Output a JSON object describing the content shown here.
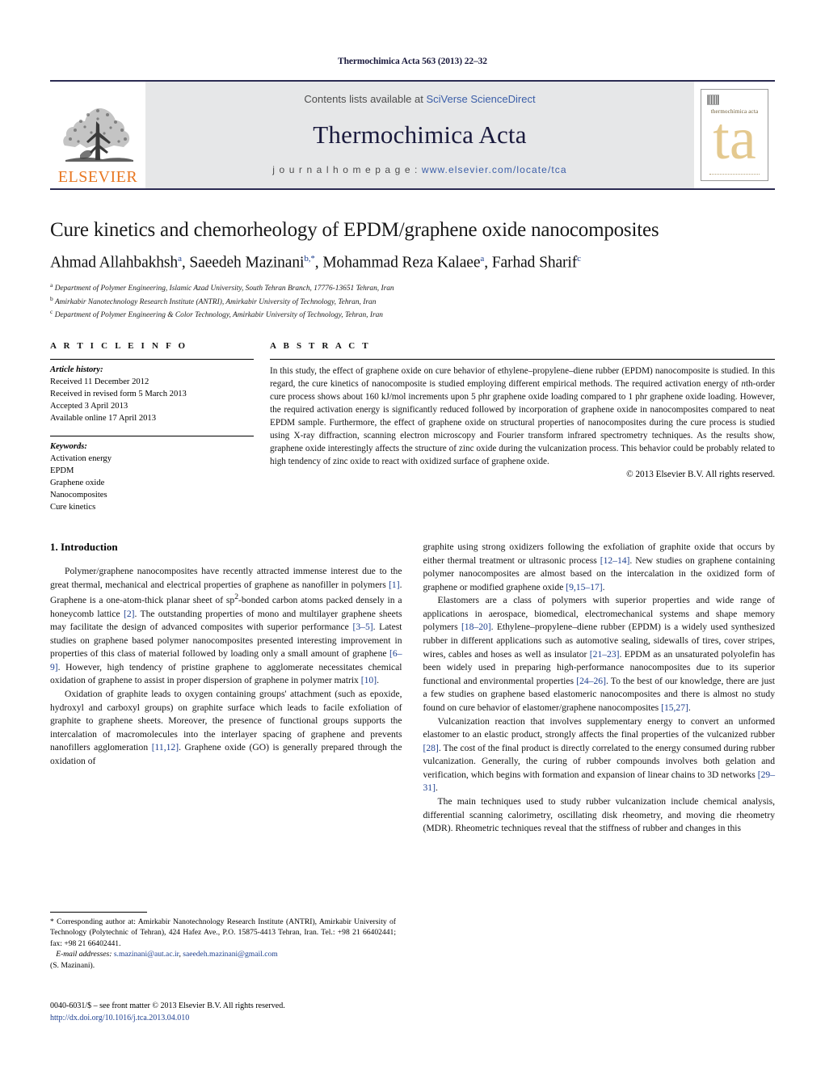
{
  "running_head": "Thermochimica Acta 563 (2013) 22–32",
  "masthead": {
    "publisher_name": "ELSEVIER",
    "contents_prefix": "Contents lists available at ",
    "contents_link": "SciVerse ScienceDirect",
    "journal_name": "Thermochimica Acta",
    "homepage_prefix": "j o u r n a l   h o m e p a g e :   ",
    "homepage_url": "www.elsevier.com/locate/tca",
    "cover_title": "thermochimica acta",
    "cover_logo_text": "ta",
    "accent_orange": "#E87722",
    "accent_blue": "#3b5ea8",
    "band_gray": "#e6e7e8",
    "cover_tan": "#e4c98f"
  },
  "article": {
    "title": "Cure kinetics and chemorheology of EPDM/graphene oxide nanocomposites",
    "authors_html": "Ahmad Allahbakhsh<sup>a</sup>, Saeedeh Mazinani<sup>b,*</sup>, Mohammad Reza Kalaee<sup>a</sup>, Farhad Sharif<sup>c</sup>",
    "affiliations": [
      "Department of Polymer Engineering, Islamic Azad University, South Tehran Branch, 17776-13651 Tehran, Iran",
      "Amirkabir Nanotechnology Research Institute (ANTRI), Amirkabir University of Technology, Tehran, Iran",
      "Department of Polymer Engineering & Color Technology, Amirkabir University of Technology, Tehran, Iran"
    ],
    "affiliation_marks": [
      "a",
      "b",
      "c"
    ]
  },
  "article_info": {
    "heading": "A R T I C L E   I N F O",
    "history_label": "Article history:",
    "history": [
      "Received 11 December 2012",
      "Received in revised form 5 March 2013",
      "Accepted 3 April 2013",
      "Available online 17 April 2013"
    ],
    "keywords_label": "Keywords:",
    "keywords": [
      "Activation energy",
      "EPDM",
      "Graphene oxide",
      "Nanocomposites",
      "Cure kinetics"
    ]
  },
  "abstract": {
    "heading": "A B S T R A C T",
    "text": "In this study, the effect of graphene oxide on cure behavior of ethylene–propylene–diene rubber (EPDM) nanocomposite is studied. In this regard, the cure kinetics of nanocomposite is studied employing different empirical methods. The required activation energy of nth-order cure process shows about 160 kJ/mol increments upon 5 phr graphene oxide loading compared to 1 phr graphene oxide loading. However, the required activation energy is significantly reduced followed by incorporation of graphene oxide in nanocomposites compared to neat EPDM sample. Furthermore, the effect of graphene oxide on structural properties of nanocomposites during the cure process is studied using X-ray diffraction, scanning electron microscopy and Fourier transform infrared spectrometry techniques. As the results show, graphene oxide interestingly affects the structure of zinc oxide during the vulcanization process. This behavior could be probably related to high tendency of zinc oxide to react with oxidized surface of graphene oxide.",
    "copyright": "© 2013 Elsevier B.V. All rights reserved."
  },
  "introduction": {
    "section_number_title": "1.  Introduction",
    "left_paragraphs": [
      "Polymer/graphene nanocomposites have recently attracted immense interest due to the great thermal, mechanical and electrical properties of graphene as nanofiller in polymers [1]. Graphene is a one-atom-thick planar sheet of sp2-bonded carbon atoms packed densely in a honeycomb lattice [2]. The outstanding properties of mono and multilayer graphene sheets may facilitate the design of advanced composites with superior performance [3–5]. Latest studies on graphene based polymer nanocomposites presented interesting improvement in properties of this class of material followed by loading only a small amount of graphene [6–9]. However, high tendency of pristine graphene to agglomerate necessitates chemical oxidation of graphene to assist in proper dispersion of graphene in polymer matrix [10].",
      "Oxidation of graphite leads to oxygen containing groups' attachment (such as epoxide, hydroxyl and carboxyl groups) on graphite surface which leads to facile exfoliation of graphite to graphene sheets. Moreover, the presence of functional groups supports the intercalation of macromolecules into the interlayer spacing of graphene and prevents nanofillers agglomeration [11,12]. Graphene oxide (GO) is generally prepared through the oxidation of"
    ],
    "right_paragraphs": [
      "graphite using strong oxidizers following the exfoliation of graphite oxide that occurs by either thermal treatment or ultrasonic process [12–14]. New studies on graphene containing polymer nanocomposites are almost based on the intercalation in the oxidized form of graphene or modified graphene oxide [9,15–17].",
      "Elastomers are a class of polymers with superior properties and wide range of applications in aerospace, biomedical, electromechanical systems and shape memory polymers [18–20]. Ethylene–propylene–diene rubber (EPDM) is a widely used synthesized rubber in different applications such as automotive sealing, sidewalls of tires, cover stripes, wires, cables and hoses as well as insulator [21–23]. EPDM as an unsaturated polyolefin has been widely used in preparing high-performance nanocomposites due to its superior functional and environmental properties [24–26]. To the best of our knowledge, there are just a few studies on graphene based elastomeric nanocomposites and there is almost no study found on cure behavior of elastomer/graphene nanocomposites [15,27].",
      "Vulcanization reaction that involves supplementary energy to convert an unformed elastomer to an elastic product, strongly affects the final properties of the vulcanized rubber [28]. The cost of the final product is directly correlated to the energy consumed during rubber vulcanization. Generally, the curing of rubber compounds involves both gelation and verification, which begins with formation and expansion of linear chains to 3D networks [29–31].",
      "The main techniques used to study rubber vulcanization include chemical analysis, differential scanning calorimetry, oscillating disk rheometry, and moving die rheometry (MDR). Rheometric techniques reveal that the stiffness of rubber and changes in this"
    ]
  },
  "footnote": {
    "corresponding_text": "* Corresponding author at: Amirkabir Nanotechnology Research Institute (ANTRI), Amirkabir University of Technology (Polytechnic of Tehran), 424 Hafez Ave., P.O. 15875-4413 Tehran, Iran. Tel.: +98 21 66402441; fax: +98 21 66402441.",
    "email_label": "E-mail addresses:",
    "email_1": "s.mazinani@aut.ac.ir",
    "email_2": "saeedeh.mazinani@gmail.com",
    "email_attrib": "(S. Mazinani)."
  },
  "issn_block": {
    "line1": "0040-6031/$ – see front matter © 2013 Elsevier B.V. All rights reserved.",
    "doi": "http://dx.doi.org/10.1016/j.tca.2013.04.010"
  }
}
